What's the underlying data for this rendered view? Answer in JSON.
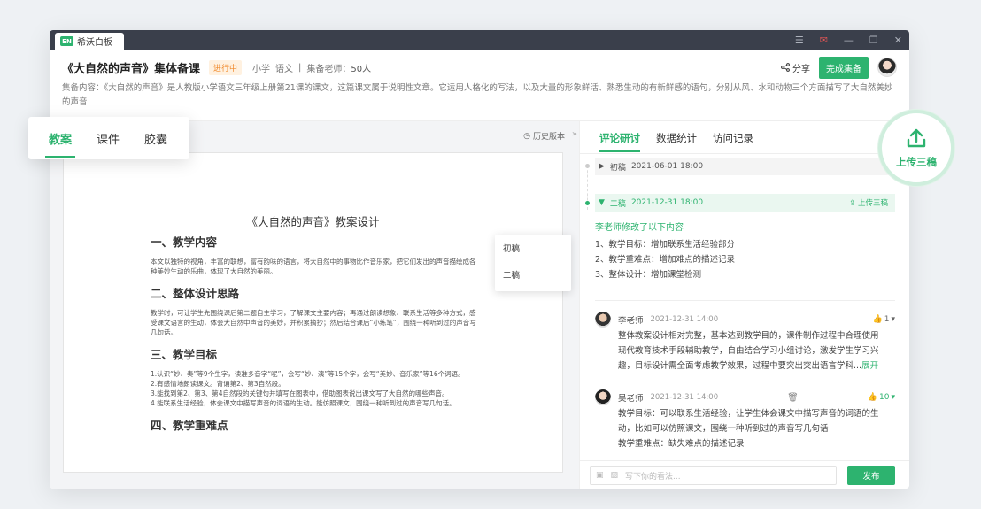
{
  "window": {
    "app_title": "希沃白板",
    "logo_text": "EN"
  },
  "header": {
    "title": "《大自然的声音》集体备课",
    "status": "进行中",
    "grade": "小学",
    "subject": "语文",
    "teachers_label": "集备老师：",
    "teachers_count": "50人",
    "share_label": "分享",
    "finish_label": "完成集备"
  },
  "description": "集备内容：《大自然的声音》是人教版小学语文三年级上册第21课的课文，这篇课文属于说明性文章。它运用人格化的写法，以及大量的形象鲜活、熟悉生动的有新鲜感的语句，分别从风、水和动物三个方面描写了大自然美妙的声音",
  "left_tabs": [
    "教案",
    "课件",
    "胶囊"
  ],
  "history_label": "历史版本",
  "version_menu": [
    "初稿",
    "二稿"
  ],
  "doc": {
    "title": "《大自然的声音》教案设计",
    "sections": [
      {
        "heading": "一、教学内容",
        "body": "本文以独特的视角，丰富的联想，富有韵味的语言，将大自然中的事物比作音乐家，把它们发出的声音描绘成各种美妙生动的乐曲，体现了大自然的美丽。"
      },
      {
        "heading": "二、整体设计思路",
        "body": "教学时，可让学生先围绕课后第二题自主学习，了解课文主要内容；再通过朗读想象、联系生活等多种方式，感受课文语言的生动，体会大自然中声音的美妙，并积累摘抄；然后结合课后“小练笔”，围绕一种听到过的声音写几句话。"
      },
      {
        "heading": "三、教学目标",
        "body": "1.认识“妙、奏”等9个生字，读准多音字“呢”，会写“妙、演”等15个字，会写“美妙、音乐家”等16个词语。\n2.有感情地朗读课文。背诵第2、第3自然段。\n3.能找到第2、第3、第4自然段的关键句并填写在图表中，借助图表说出课文写了大自然的哪些声音。\n4.能联系生活经验，体会课文中描写声音的词语的生动。能仿照课文，围绕一种听到过的声音写几句话。"
      },
      {
        "heading": "四、教学重难点",
        "body": ""
      }
    ]
  },
  "right_tabs": [
    "评论研讨",
    "数据统计",
    "访问记录"
  ],
  "versions": [
    {
      "name": "初稿",
      "date": "2021-06-01 18:00"
    },
    {
      "name": "二稿",
      "date": "2021-12-31 18:00",
      "upload_label": "上传三稿"
    }
  ],
  "modification": {
    "title": "李老师修改了以下内容",
    "items": [
      "1、教学目标：增加联系生活经验部分",
      "2、教学重难点：增加难点的描述记录",
      "3、整体设计：增加课堂检测"
    ]
  },
  "comments": [
    {
      "author": "李老师",
      "time": "2021-12-31 14:00",
      "likes": "1",
      "lines": [
        "整体教案设计相对完整，基本达到教学目的，课件制作过程中合理使用",
        "现代教育技术手段辅助教学，自由结合学习小组讨论，激发学生学习兴",
        "趣，目标设计需全面考虑教学效果，过程中要突出突出语言学科..."
      ],
      "more": "展开"
    },
    {
      "author": "吴老师",
      "time": "2021-12-31 14:00",
      "likes": "10",
      "lines": [
        "教学目标：可以联系生活经验，让学生体会课文中描写声音的词语的生",
        "动，比如可以仿照课文，围绕一种听到过的声音写几句话",
        "教学重难点：缺失难点的描述记录"
      ]
    }
  ],
  "composer": {
    "placeholder": "写下你的看法...",
    "publish_label": "发布"
  },
  "upload_badge": {
    "label": "上传三稿"
  },
  "colors": {
    "accent": "#2db36f",
    "status_orange": "#f08a2c"
  }
}
